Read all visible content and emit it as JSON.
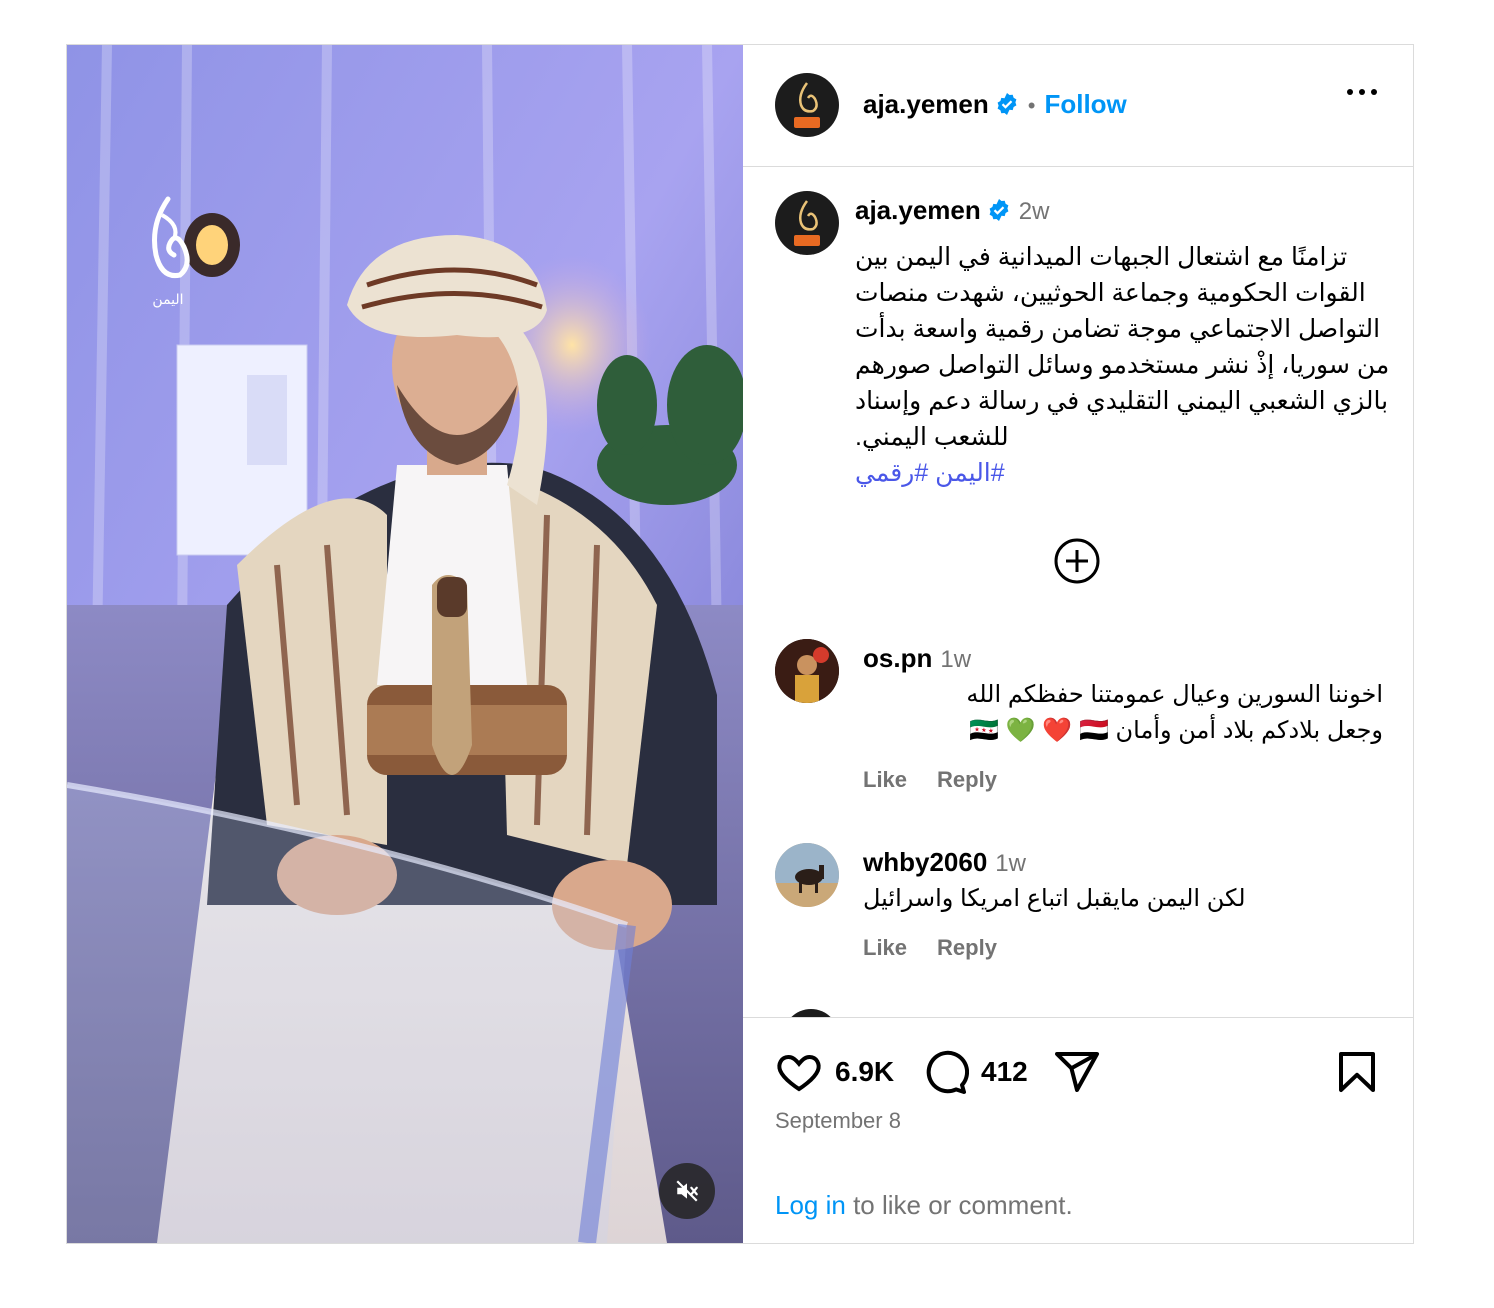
{
  "account": {
    "username": "aja.yemen",
    "follow_label": "Follow",
    "separator": "•"
  },
  "media": {
    "watermark": "اليمن"
  },
  "caption": {
    "username": "aja.yemen",
    "time": "2w",
    "text": "تزامنًا مع اشتعال الجبهات الميدانية في اليمن بين القوات الحكومية وجماعة الحوثيين، شهدت منصات التواصل الاجتماعي موجة تضامن رقمية واسعة بدأت من سوريا، إذْ نشر مستخدمو وسائل التواصل صورهم بالزي الشعبي اليمني التقليدي في رسالة دعم وإسناد للشعب اليمني.",
    "hashtags": "#اليمن #رقمي"
  },
  "comments": [
    {
      "username": "os.pn",
      "time": "1w",
      "line1": "اخوننا السورين وعيال عمومتنا حفظكم الله",
      "line2": "وجعل بلادكم بلاد أمن وأمان 🇸🇾 💚 ❤️ 🇾🇪",
      "like_label": "Like",
      "reply_label": "Reply"
    },
    {
      "username": "whby2060",
      "time": "1w",
      "line1": "لكن اليمن مايقبل اتباع امريكا واسرائيل",
      "like_label": "Like",
      "reply_label": "Reply"
    }
  ],
  "footer": {
    "likes": "6.9K",
    "comments": "412",
    "date": "September 8",
    "login_link": "Log in",
    "login_rest": " to like or comment."
  },
  "icons": {
    "header_more": "more-icon",
    "verified": "verified-badge-icon",
    "load_more": "plus-circle-icon",
    "like": "heart-icon",
    "comment": "comment-icon",
    "share": "share-icon",
    "save": "bookmark-icon",
    "mute": "speaker-muted-icon"
  },
  "colors": {
    "link_blue": "#0095f6",
    "hashtag": "#4a57e8",
    "secondary_text": "#737373",
    "border": "#dbdbdb"
  }
}
